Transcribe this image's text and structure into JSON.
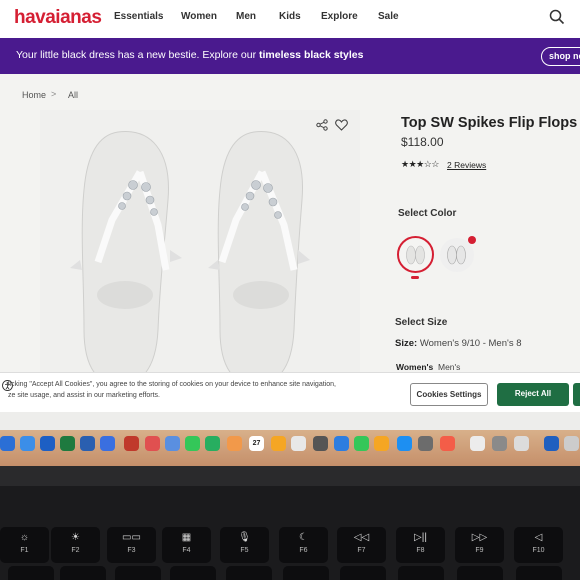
{
  "brand": {
    "logo": "havaianas",
    "accent": "#d51f33",
    "promo_bg": "#4a1a8e"
  },
  "nav": {
    "items": [
      "Essentials",
      "Women",
      "Men",
      "Kids",
      "Explore",
      "Sale"
    ]
  },
  "promo": {
    "text": "Your little black dress has a new bestie. Explore our ",
    "bold": "timeless black styles",
    "button": "shop no"
  },
  "breadcrumb": {
    "home": "Home",
    "sep": ">",
    "current": "All"
  },
  "product": {
    "title": "Top SW Spikes Flip Flops",
    "price": "$118.00",
    "rating": 3,
    "reviews": "2 Reviews",
    "select_color": "Select Color",
    "select_size": "Select Size",
    "size_label": "Size:",
    "size_value": " Women's 9/10 - Men's 8",
    "size_tab_women": "Women's",
    "size_tab_men": "Men's"
  },
  "cookie": {
    "text_line1": "licking \"Accept All Cookies\", you agree to the storing of cookies on your device to enhance site navigation,",
    "text_line2": "ze site usage, and assist in our marketing efforts.",
    "settings_btn": "Cookies Settings",
    "reject_btn": "Reject All"
  },
  "dock": {
    "calendar_day": "27"
  },
  "keyboard": {
    "fkeys": [
      {
        "sym": "☼",
        "label": "F1"
      },
      {
        "sym": "☀",
        "label": "F2"
      },
      {
        "sym": "▭▭",
        "label": "F3"
      },
      {
        "sym": "▦",
        "label": "F4"
      },
      {
        "sym": "🎙",
        "label": "F5"
      },
      {
        "sym": "☾",
        "label": "F6"
      },
      {
        "sym": "◁◁",
        "label": "F7"
      },
      {
        "sym": "▷||",
        "label": "F8"
      },
      {
        "sym": "▷▷",
        "label": "F9"
      },
      {
        "sym": "◁",
        "label": "F10"
      }
    ]
  }
}
